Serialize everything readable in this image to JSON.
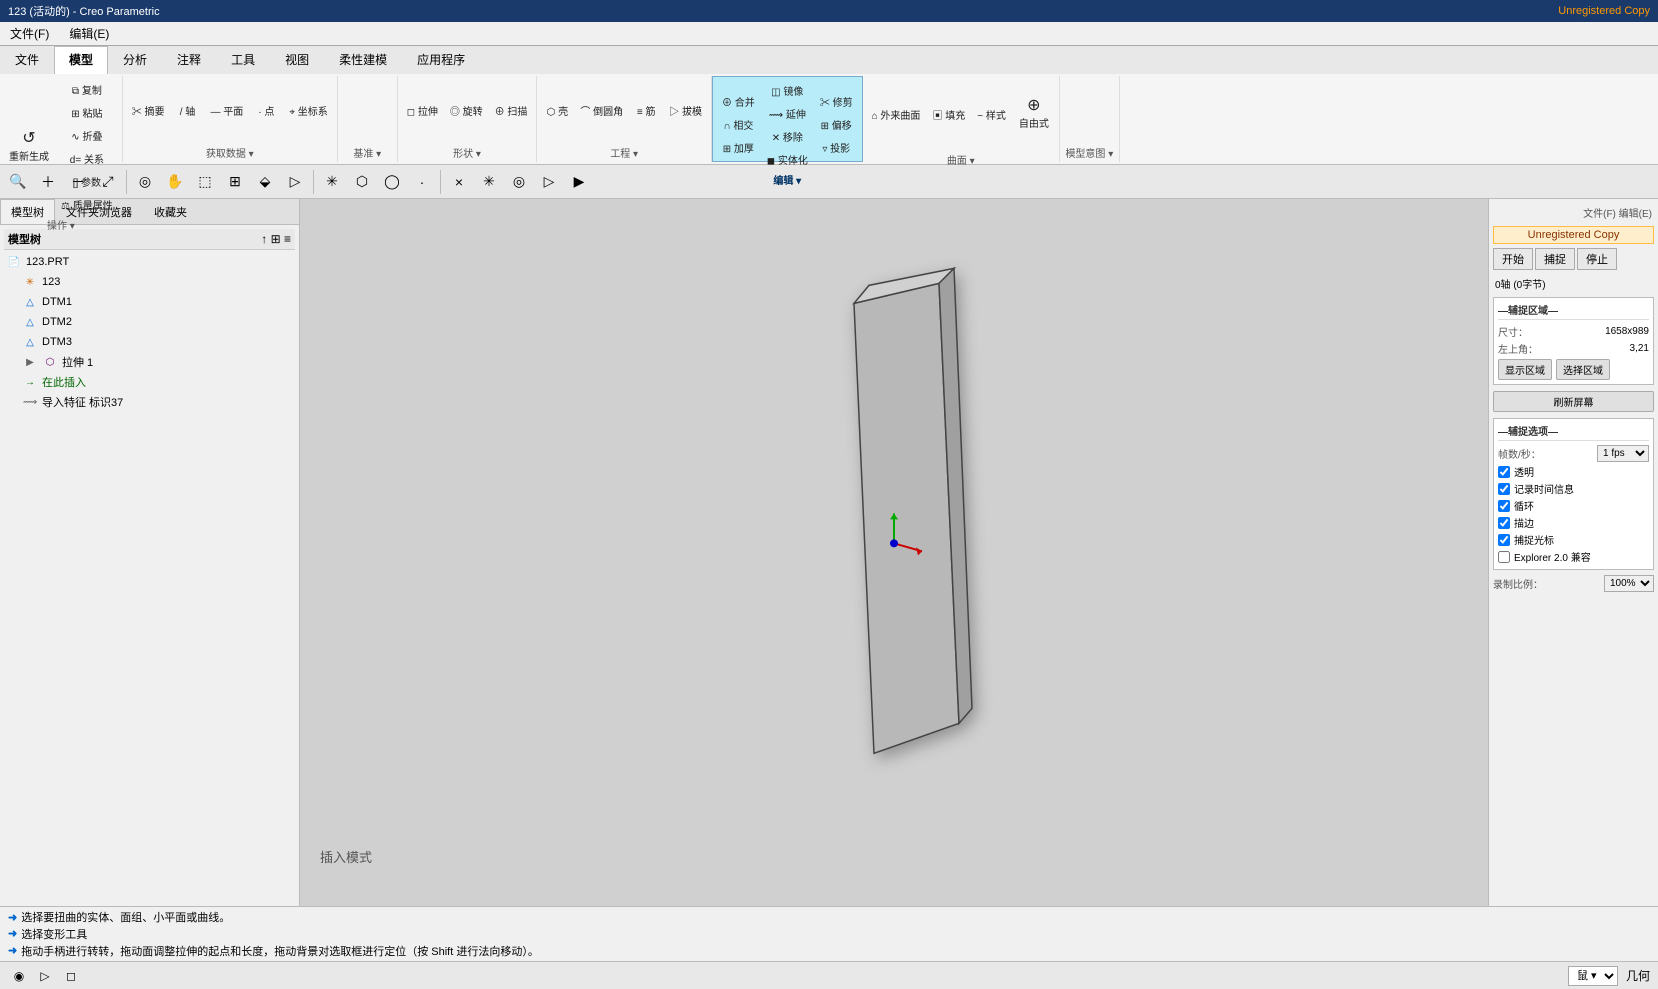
{
  "title": {
    "main": "123 (活动的) - Creo Parametric",
    "unregistered": "Unregistered Copy"
  },
  "menubar": {
    "items": [
      "文件(F)",
      "编辑(E)"
    ]
  },
  "ribbon": {
    "tabs": [
      "文件",
      "模型",
      "分析",
      "注释",
      "工具",
      "视图",
      "柔性建模",
      "应用程序"
    ],
    "active_tab": "模型",
    "editing_tab": "编辑",
    "groups": [
      {
        "label": "操作 ▾",
        "buttons": [
          {
            "icon": "↺",
            "label": "重新生成"
          },
          {
            "icon": "⧉",
            "label": "复制"
          },
          {
            "icon": "⊞",
            "label": "粘贴"
          },
          {
            "icon": "∿",
            "label": "折叠"
          },
          {
            "icon": "d=",
            "label": "关系"
          },
          {
            "icon": "[]",
            "label": "参数"
          },
          {
            "icon": "⚖",
            "label": "质量属性"
          }
        ]
      },
      {
        "label": "获取数据 ▾",
        "buttons": [
          {
            "icon": "✂",
            "label": "摘要"
          },
          {
            "icon": "/",
            "label": "轴"
          },
          {
            "icon": "—",
            "label": "平面"
          },
          {
            "icon": "·",
            "label": "点"
          },
          {
            "icon": "⌖",
            "label": "坐标系"
          }
        ]
      },
      {
        "label": "基准 ▾",
        "buttons": []
      },
      {
        "label": "形状 ▾",
        "buttons": [
          {
            "icon": "◻",
            "label": "拉伸"
          },
          {
            "icon": "◎",
            "label": "旋转"
          },
          {
            "icon": "⊕",
            "label": "扫描"
          }
        ]
      },
      {
        "label": "工程 ▾",
        "buttons": [
          {
            "icon": "⬡",
            "label": "壳"
          },
          {
            "icon": "⌒",
            "label": "倒圆角"
          },
          {
            "icon": "≡",
            "label": "筋"
          },
          {
            "icon": "▷",
            "label": "拔模"
          }
        ]
      },
      {
        "label": "编辑 ▾",
        "buttons": [
          {
            "icon": "⊕",
            "label": "合并"
          },
          {
            "icon": "∩",
            "label": "相交"
          },
          {
            "icon": "⊞",
            "label": "加厚"
          },
          {
            "icon": "◫",
            "label": "镜像"
          },
          {
            "icon": "⟿",
            "label": "延伸"
          },
          {
            "icon": "✕",
            "label": "移除"
          },
          {
            "icon": "◼",
            "label": "实体化"
          },
          {
            "icon": "✂",
            "label": "修剪"
          },
          {
            "icon": "⊞",
            "label": "偏移"
          },
          {
            "icon": "▿",
            "label": "投影"
          }
        ]
      },
      {
        "label": "曲面 ▾",
        "buttons": [
          {
            "icon": "⌂",
            "label": "外来曲面"
          },
          {
            "icon": "▣",
            "label": "填充"
          },
          {
            "icon": "~",
            "label": "样式"
          },
          {
            "icon": "⊕",
            "label": "自由式"
          }
        ]
      },
      {
        "label": "模型意图 ▾",
        "buttons": []
      }
    ]
  },
  "secondary_toolbar": {
    "tools": [
      "🔍",
      "＋",
      "－",
      "⤢",
      "◯",
      "◻",
      "⬚",
      "⊞",
      "⬙",
      "▷",
      "✳",
      "⬡",
      "◯",
      "/",
      "×",
      "✳",
      "◎",
      "▷",
      "▶"
    ]
  },
  "left_panel": {
    "tabs": [
      "模型树",
      "文件夹浏览器",
      "收藏夹"
    ],
    "active_tab": "模型树",
    "tree": {
      "title": "模型树",
      "items": [
        {
          "id": "root",
          "label": "123.PRT",
          "icon": "📄",
          "level": 0,
          "expanded": true
        },
        {
          "id": "feature123",
          "label": "123",
          "icon": "✳",
          "level": 1
        },
        {
          "id": "dtm1",
          "label": "DTM1",
          "icon": "△",
          "level": 1
        },
        {
          "id": "dtm2",
          "label": "DTM2",
          "icon": "△",
          "level": 1
        },
        {
          "id": "dtm3",
          "label": "DTM3",
          "icon": "△",
          "level": 1
        },
        {
          "id": "extrude1",
          "label": "拉伸 1",
          "icon": "◻",
          "level": 1,
          "has_arrow": true
        },
        {
          "id": "insert",
          "label": "在此插入",
          "icon": "→",
          "level": 1,
          "color": "green"
        },
        {
          "id": "import",
          "label": "导入特征 标识37",
          "icon": "⟿",
          "level": 1
        }
      ]
    }
  },
  "viewport": {
    "label": "插入模式",
    "background": "#d0d0d0"
  },
  "right_panel": {
    "file_label": "文件(F)",
    "edit_label": "编辑(E)",
    "unregistered": "Unregistered Copy",
    "top_buttons": [
      "开始",
      "捕捉",
      "停止"
    ],
    "axis_label": "0轴 (0字节)",
    "dimensions_section": {
      "title": "辅捉区域",
      "size_label": "尺寸：",
      "size_value": "1658x989",
      "angle_label": "左上角：",
      "angle_value": "3,21",
      "display_area_label": "显示区域",
      "select_area_label": "选择区域"
    },
    "clear_screen_btn": "刷新屏幕",
    "capture_section": {
      "title": "辅捉选项",
      "fps_label": "帧数/秒：",
      "fps_value": "1 fps",
      "options": [
        {
          "label": "透明",
          "checked": true
        },
        {
          "label": "记录时间信息",
          "checked": true
        },
        {
          "label": "循环",
          "checked": true
        },
        {
          "label": "描边",
          "checked": true
        },
        {
          "label": "捕捉光标",
          "checked": true
        },
        {
          "label": "Explorer 2.0 兼容",
          "checked": false
        }
      ]
    },
    "ratio_label": "录制比例：",
    "ratio_value": "100%"
  },
  "status_bar": {
    "lines": [
      "选择要扭曲的实体、面组、小平面或曲线。",
      "选择变形工具",
      "拖动手柄进行转转，拖动面调整拉伸的起点和长度，拖动背景对选取框进行定位（按 Shift 进行法向移动）。"
    ]
  },
  "bottom_bar": {
    "left_icons": [
      "◉",
      "▷",
      "◻"
    ],
    "right_items": [
      "鼠 ▾",
      "几何"
    ]
  }
}
